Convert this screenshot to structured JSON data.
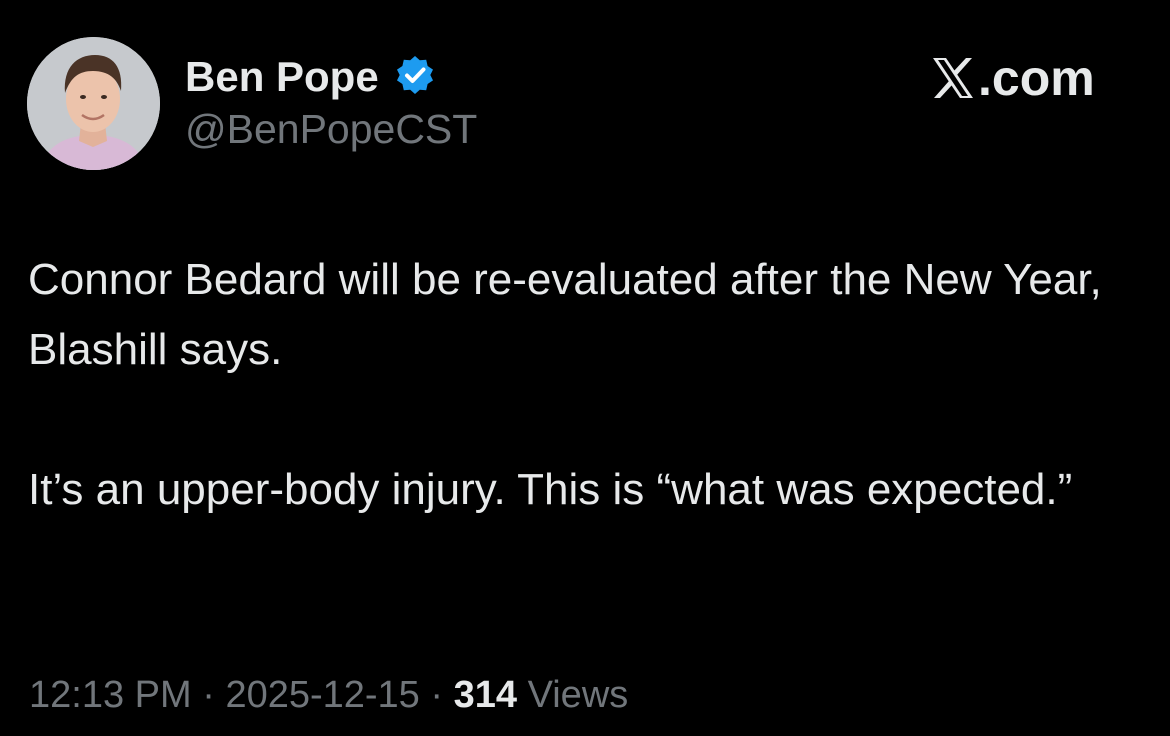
{
  "author": {
    "display_name": "Ben Pope",
    "handle": "@BenPopeCST",
    "verified": true,
    "avatar": "profile-photo"
  },
  "brand": {
    "logo": "x-logo-icon",
    "suffix": ".com"
  },
  "tweet": {
    "paragraphs": [
      "Connor Bedard will be re-evaluated after the New Year, Blashill says.",
      "It’s an upper-body injury. This is “what was expected.”"
    ]
  },
  "meta": {
    "time": "12:13 PM",
    "separator": "·",
    "date": "2025-12-15",
    "views_count": "314",
    "views_label": "Views"
  },
  "colors": {
    "background": "#000000",
    "primary_text": "#e7e9ea",
    "secondary_text": "#71767b",
    "verified_badge": "#1d9bf0"
  }
}
